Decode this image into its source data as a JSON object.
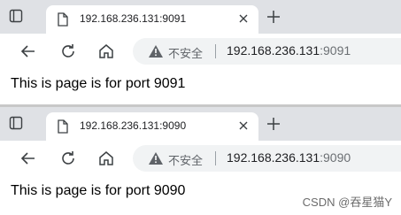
{
  "windows": [
    {
      "tab": {
        "title": "192.168.236.131:9091"
      },
      "address": {
        "security_label": "不安全",
        "host": "192.168.236.131",
        "port": ":9091"
      },
      "page": {
        "text": "This is page is for port 9091"
      }
    },
    {
      "tab": {
        "title": "192.168.236.131:9090"
      },
      "address": {
        "security_label": "不安全",
        "host": "192.168.236.131",
        "port": ":9090"
      },
      "page": {
        "text": "This is page is for port 9090"
      }
    }
  ],
  "watermark": "CSDN @吞星猫Y",
  "icons": [
    "tab-actions-icon",
    "page-icon",
    "close-icon",
    "plus-icon",
    "back-arrow-icon",
    "reload-icon",
    "home-icon",
    "warning-icon"
  ]
}
